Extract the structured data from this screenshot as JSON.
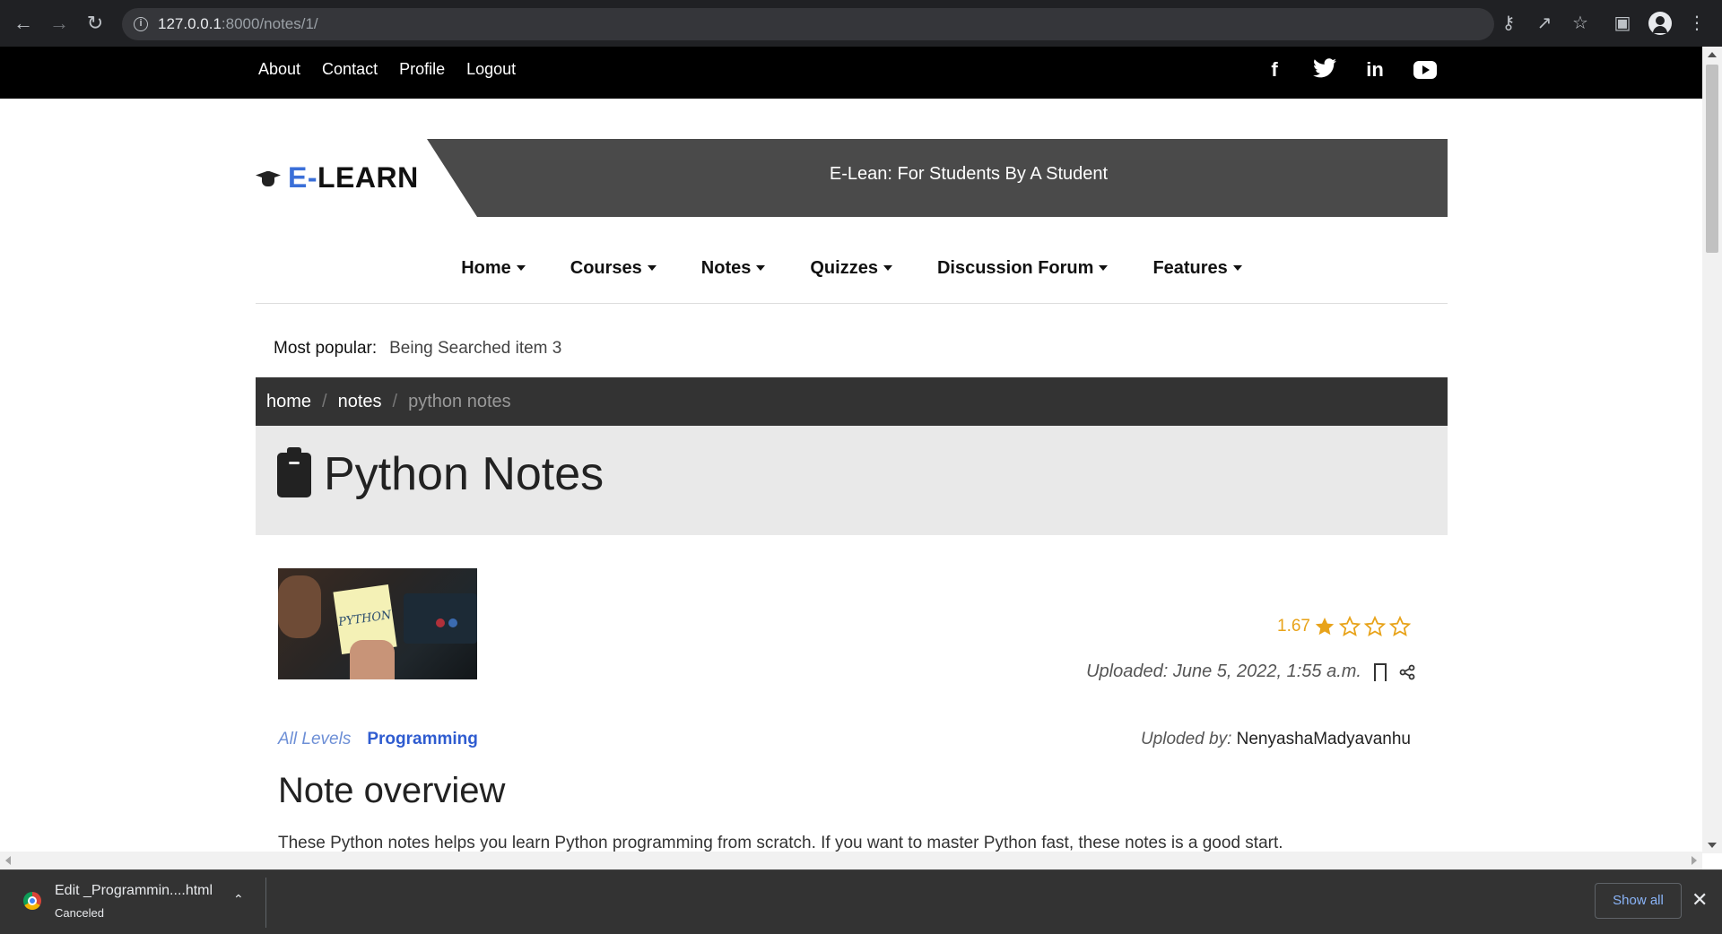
{
  "browser": {
    "url_host": "127.0.0.1",
    "url_path": ":8000/notes/1/"
  },
  "topbar": {
    "links": [
      "About",
      "Contact",
      "Profile",
      "Logout"
    ],
    "social": [
      "facebook-icon",
      "twitter-icon",
      "linkedin-icon",
      "youtube-icon"
    ]
  },
  "header": {
    "brand_prefix": "E-",
    "brand_suffix": "LEARN",
    "tagline": "E-Lean: For Students By A Student"
  },
  "nav": {
    "items": [
      "Home",
      "Courses",
      "Notes",
      "Quizzes",
      "Discussion Forum",
      "Features"
    ]
  },
  "popular": {
    "label": "Most popular:",
    "value": "Being Searched item 3"
  },
  "breadcrumb": {
    "home": "home",
    "notes": "notes",
    "current": "python notes"
  },
  "page": {
    "title": "Python Notes"
  },
  "note": {
    "thumbnail_text": "PYTHON",
    "level": "All Levels",
    "category": "Programming",
    "rating": "1.67",
    "rating_value": 1.67,
    "rating_max": 4,
    "uploaded_label": "Uploaded:",
    "uploaded_date": "June 5, 2022, 1:55 a.m.",
    "uploader_label": "Uploded by:",
    "uploader": "NenyashaMadyavanhu",
    "overview_title": "Note overview",
    "overview_text": "These Python notes helps you learn Python programming from scratch. If you want to master Python fast, these notes is a good start."
  },
  "downloads": {
    "filename": "Edit _Programmin....html",
    "status": "Canceled",
    "show_all": "Show all"
  },
  "colors": {
    "accent": "#3a6fd8",
    "rating": "#e8a31a",
    "topbar": "#000000",
    "breadcrumb": "#333333"
  }
}
